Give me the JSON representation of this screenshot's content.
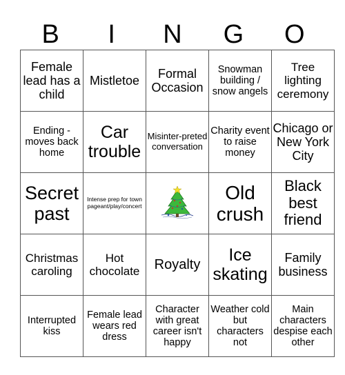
{
  "header": {
    "letters": [
      "B",
      "I",
      "N",
      "G",
      "O"
    ]
  },
  "board": {
    "rows": [
      [
        "Female lead has a child",
        "Mistletoe",
        "Formal Occasion",
        "Snowman building / snow angels",
        "Tree lighting ceremony"
      ],
      [
        "Ending - moves back home",
        "Car trouble",
        "Misinter-preted conversation",
        "Charity event to raise money",
        "Chicago or New York City"
      ],
      [
        "Secret past",
        "Intense prep for town pageant/play/concert",
        "",
        "Old crush",
        "Black best friend"
      ],
      [
        "Christmas caroling",
        "Hot chocolate",
        "Royalty",
        "Ice skating",
        "Family business"
      ],
      [
        "Interrupted kiss",
        "Female lead wears red dress",
        "Character with great career isn't happy",
        "Weather cold but characters not",
        "Main characters despise each other"
      ]
    ],
    "free_space": {
      "icon": "christmas-tree-icon",
      "row": 2,
      "col": 2
    }
  },
  "colors": {
    "grid_line": "#555555",
    "tree_green": "#3cb83c",
    "star_yellow": "#f2e02a"
  }
}
